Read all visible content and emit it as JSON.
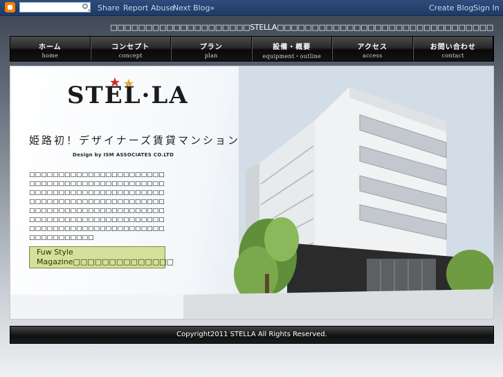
{
  "navbar": {
    "search": {
      "value": "",
      "placeholder": ""
    },
    "links": {
      "share": "Share",
      "report_abuse": "Report Abuse",
      "next_blog": "Next Blog»",
      "create_blog": "Create Blog",
      "sign_in": "Sign In"
    }
  },
  "header": {
    "text": "□□□□□□□□□□□□□□□□□□□□STELLA□□□□□□□□□□□□□□□□□□□□□□□□□□□□□□□"
  },
  "menu": [
    {
      "jp": "ホーム",
      "en": "home"
    },
    {
      "jp": "コンセプト",
      "en": "concept"
    },
    {
      "jp": "プラン",
      "en": "plan"
    },
    {
      "jp": "設備・概要",
      "en": "equipment・outline"
    },
    {
      "jp": "アクセス",
      "en": "access"
    },
    {
      "jp": "お問い合わせ",
      "en": "contact"
    }
  ],
  "main": {
    "logo_text": "STEL·LA",
    "catch_copy": "姫路初！デザイナーズ賃貸マンション",
    "design_by": "Design by ISM ASSOCIATES CO.LTD",
    "description": "□□□□□□□□□□□□□□□□□□□□□□□□□□□□□□□□□□□□□□□□□□□□□□□□□□□□□□□□□□□□□□□□□□□□□□□□□□□□□□□□□□□□□□□□□□□□□□□□□□□□□□□□□□□□□□□□□□□□□□□□□□□□□□□□□□□□□□□□□□□□□□□□□□□□□□□□□□□□□□□□□□□□□□□□□□□□",
    "magazine_link": "Fuw Style Magazine□□□□□□□□□□□□□□"
  },
  "footer": {
    "copyright": "Copyright2011 STELLA All Rights Reserved."
  }
}
